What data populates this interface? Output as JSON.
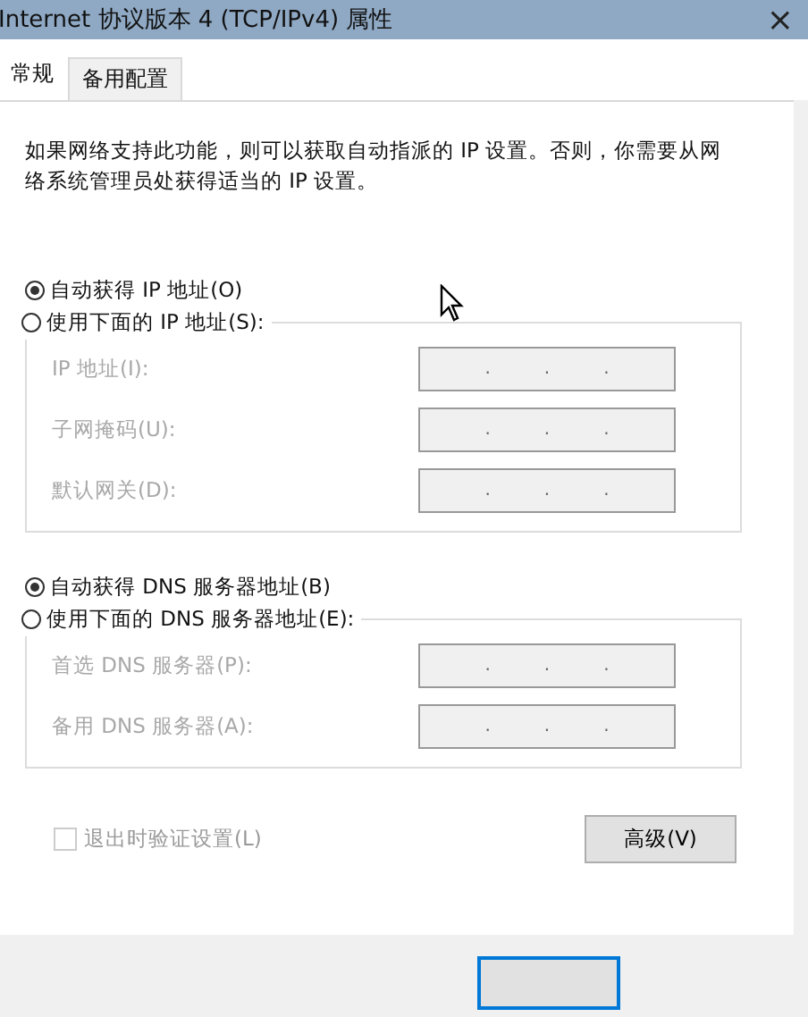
{
  "window": {
    "title": "Internet 协议版本 4 (TCP/IPv4) 属性",
    "close": "×"
  },
  "tabs": [
    {
      "label": "常规",
      "selected": true
    },
    {
      "label": "备用配置",
      "selected": false
    }
  ],
  "intro": "如果网络支持此功能，则可以获取自动指派的 IP 设置。否则，你需要从网络系统管理员处获得适当的 IP 设置。",
  "sections": [
    {
      "options": [
        {
          "label": "自动获得 IP 地址(O)",
          "selected": true
        },
        {
          "label": "使用下面的 IP 地址(S):",
          "selected": false
        }
      ],
      "disabled": true,
      "fields": [
        {
          "label": "IP 地址(I):",
          "separators": [
            ".",
            ".",
            "."
          ]
        },
        {
          "label": "子网掩码(U):",
          "separators": [
            ".",
            ".",
            "."
          ]
        },
        {
          "label": "默认网关(D):",
          "separators": [
            ".",
            ".",
            "."
          ]
        }
      ]
    },
    {
      "options": [
        {
          "label": "自动获得 DNS 服务器地址(B)",
          "selected": true
        },
        {
          "label": "使用下面的 DNS 服务器地址(E):",
          "selected": false
        }
      ],
      "disabled": true,
      "fields": [
        {
          "label": "首选 DNS 服务器(P):",
          "separators": [
            ".",
            ".",
            "."
          ]
        },
        {
          "label": "备用 DNS 服务器(A):",
          "separators": [
            ".",
            ".",
            "."
          ]
        }
      ]
    }
  ],
  "validate": {
    "label": "退出时验证设置(L)",
    "checked": false,
    "disabled": true
  },
  "advanced_button": "高级(V)"
}
